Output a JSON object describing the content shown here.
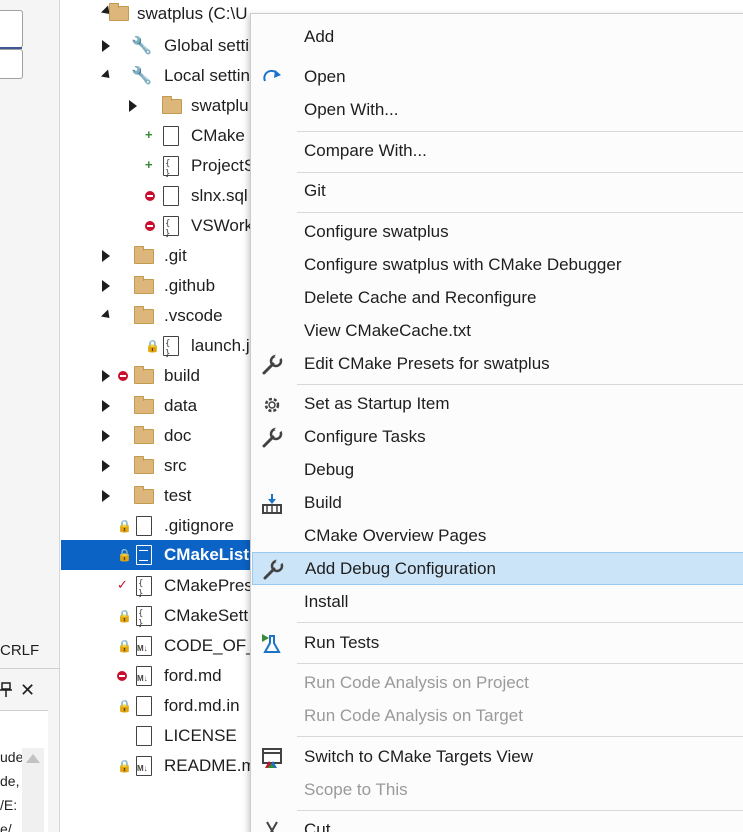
{
  "left_panel": {
    "line_ending": "CRLF",
    "pin_glyph": "⊥",
    "close_glyph": "✕",
    "snippets": [
      "ude",
      "de,",
      "/E:",
      "e/"
    ]
  },
  "tree": {
    "rows": [
      {
        "label": "swatplus (C:\\Users\\...\\swatplus)",
        "display": "swatplus (C:\\U",
        "kind": "folder"
      },
      {
        "label": "Global settings",
        "display": "Global setti",
        "kind": "wrench"
      },
      {
        "label": "Local settings",
        "display": "Local settin",
        "kind": "wrench"
      },
      {
        "label": "swatplus",
        "display": "swatplu",
        "kind": "folder"
      },
      {
        "label": "CMake",
        "display": "CMake",
        "kind": "file"
      },
      {
        "label": "ProjectSettings",
        "display": "ProjectS",
        "kind": "json"
      },
      {
        "label": "slnx.sqlite",
        "display": "slnx.sql",
        "kind": "file"
      },
      {
        "label": "VSWorkspaceState",
        "display": "VSWork",
        "kind": "json"
      },
      {
        "label": ".git",
        "display": ".git",
        "kind": "folder"
      },
      {
        "label": ".github",
        "display": ".github",
        "kind": "folder"
      },
      {
        "label": ".vscode",
        "display": ".vscode",
        "kind": "folder"
      },
      {
        "label": "launch.json",
        "display": "launch.j",
        "kind": "json"
      },
      {
        "label": "build",
        "display": "build",
        "kind": "folder"
      },
      {
        "label": "data",
        "display": "data",
        "kind": "folder"
      },
      {
        "label": "doc",
        "display": "doc",
        "kind": "folder"
      },
      {
        "label": "src",
        "display": "src",
        "kind": "folder"
      },
      {
        "label": "test",
        "display": "test",
        "kind": "folder"
      },
      {
        "label": ".gitignore",
        "display": ".gitignore",
        "kind": "file"
      },
      {
        "label": "CMakeLists.txt",
        "display": "CMakeList",
        "kind": "lines",
        "selected": true
      },
      {
        "label": "CMakePresets.json",
        "display": "CMakePres",
        "kind": "json"
      },
      {
        "label": "CMakeSettings.json",
        "display": "CMakeSett",
        "kind": "json"
      },
      {
        "label": "CODE_OF_CONDUCT.md",
        "display": "CODE_OF_",
        "kind": "md"
      },
      {
        "label": "ford.md",
        "display": "ford.md",
        "kind": "md"
      },
      {
        "label": "ford.md.in",
        "display": "ford.md.in",
        "kind": "file"
      },
      {
        "label": "LICENSE",
        "display": "LICENSE",
        "kind": "file"
      },
      {
        "label": "README.md",
        "display": "README.m",
        "kind": "md"
      }
    ]
  },
  "context_menu": {
    "items": [
      {
        "label": "Add",
        "icon": ""
      },
      {
        "label": "Open",
        "icon": "open-arrow-icon"
      },
      {
        "label": "Open With...",
        "icon": ""
      },
      {
        "label": "Compare With...",
        "icon": ""
      },
      {
        "label": "Git",
        "icon": ""
      },
      {
        "label": "Configure swatplus",
        "icon": ""
      },
      {
        "label": "Configure swatplus with CMake Debugger",
        "icon": ""
      },
      {
        "label": "Delete Cache and Reconfigure",
        "icon": ""
      },
      {
        "label": "View CMakeCache.txt",
        "icon": ""
      },
      {
        "label": "Edit CMake Presets for swatplus",
        "icon": "wrench-icon"
      },
      {
        "label": "Set as Startup Item",
        "icon": "gear-icon"
      },
      {
        "label": "Configure Tasks",
        "icon": "wrench-icon"
      },
      {
        "label": "Debug",
        "icon": ""
      },
      {
        "label": "Build",
        "icon": "build-icon"
      },
      {
        "label": "CMake Overview Pages",
        "icon": ""
      },
      {
        "label": "Add Debug Configuration",
        "icon": "wrench-icon",
        "highlighted": true
      },
      {
        "label": "Install",
        "icon": ""
      },
      {
        "label": "Run Tests",
        "icon": "run-tests-icon"
      },
      {
        "label": "Run Code Analysis on Project",
        "icon": "",
        "disabled": true
      },
      {
        "label": "Run Code Analysis on Target",
        "icon": "",
        "disabled": true
      },
      {
        "label": "Switch to CMake Targets View",
        "icon": "targets-view-icon"
      },
      {
        "label": "Scope to This",
        "icon": "",
        "disabled": true
      },
      {
        "label": "Cut",
        "icon": "scissors-icon"
      }
    ]
  },
  "colors": {
    "selection": "#0b63c6",
    "menu_highlight": "#cce4f7",
    "folder": "#dcb67a",
    "status_added": "#388a34",
    "status_deleted": "#c8102e"
  }
}
